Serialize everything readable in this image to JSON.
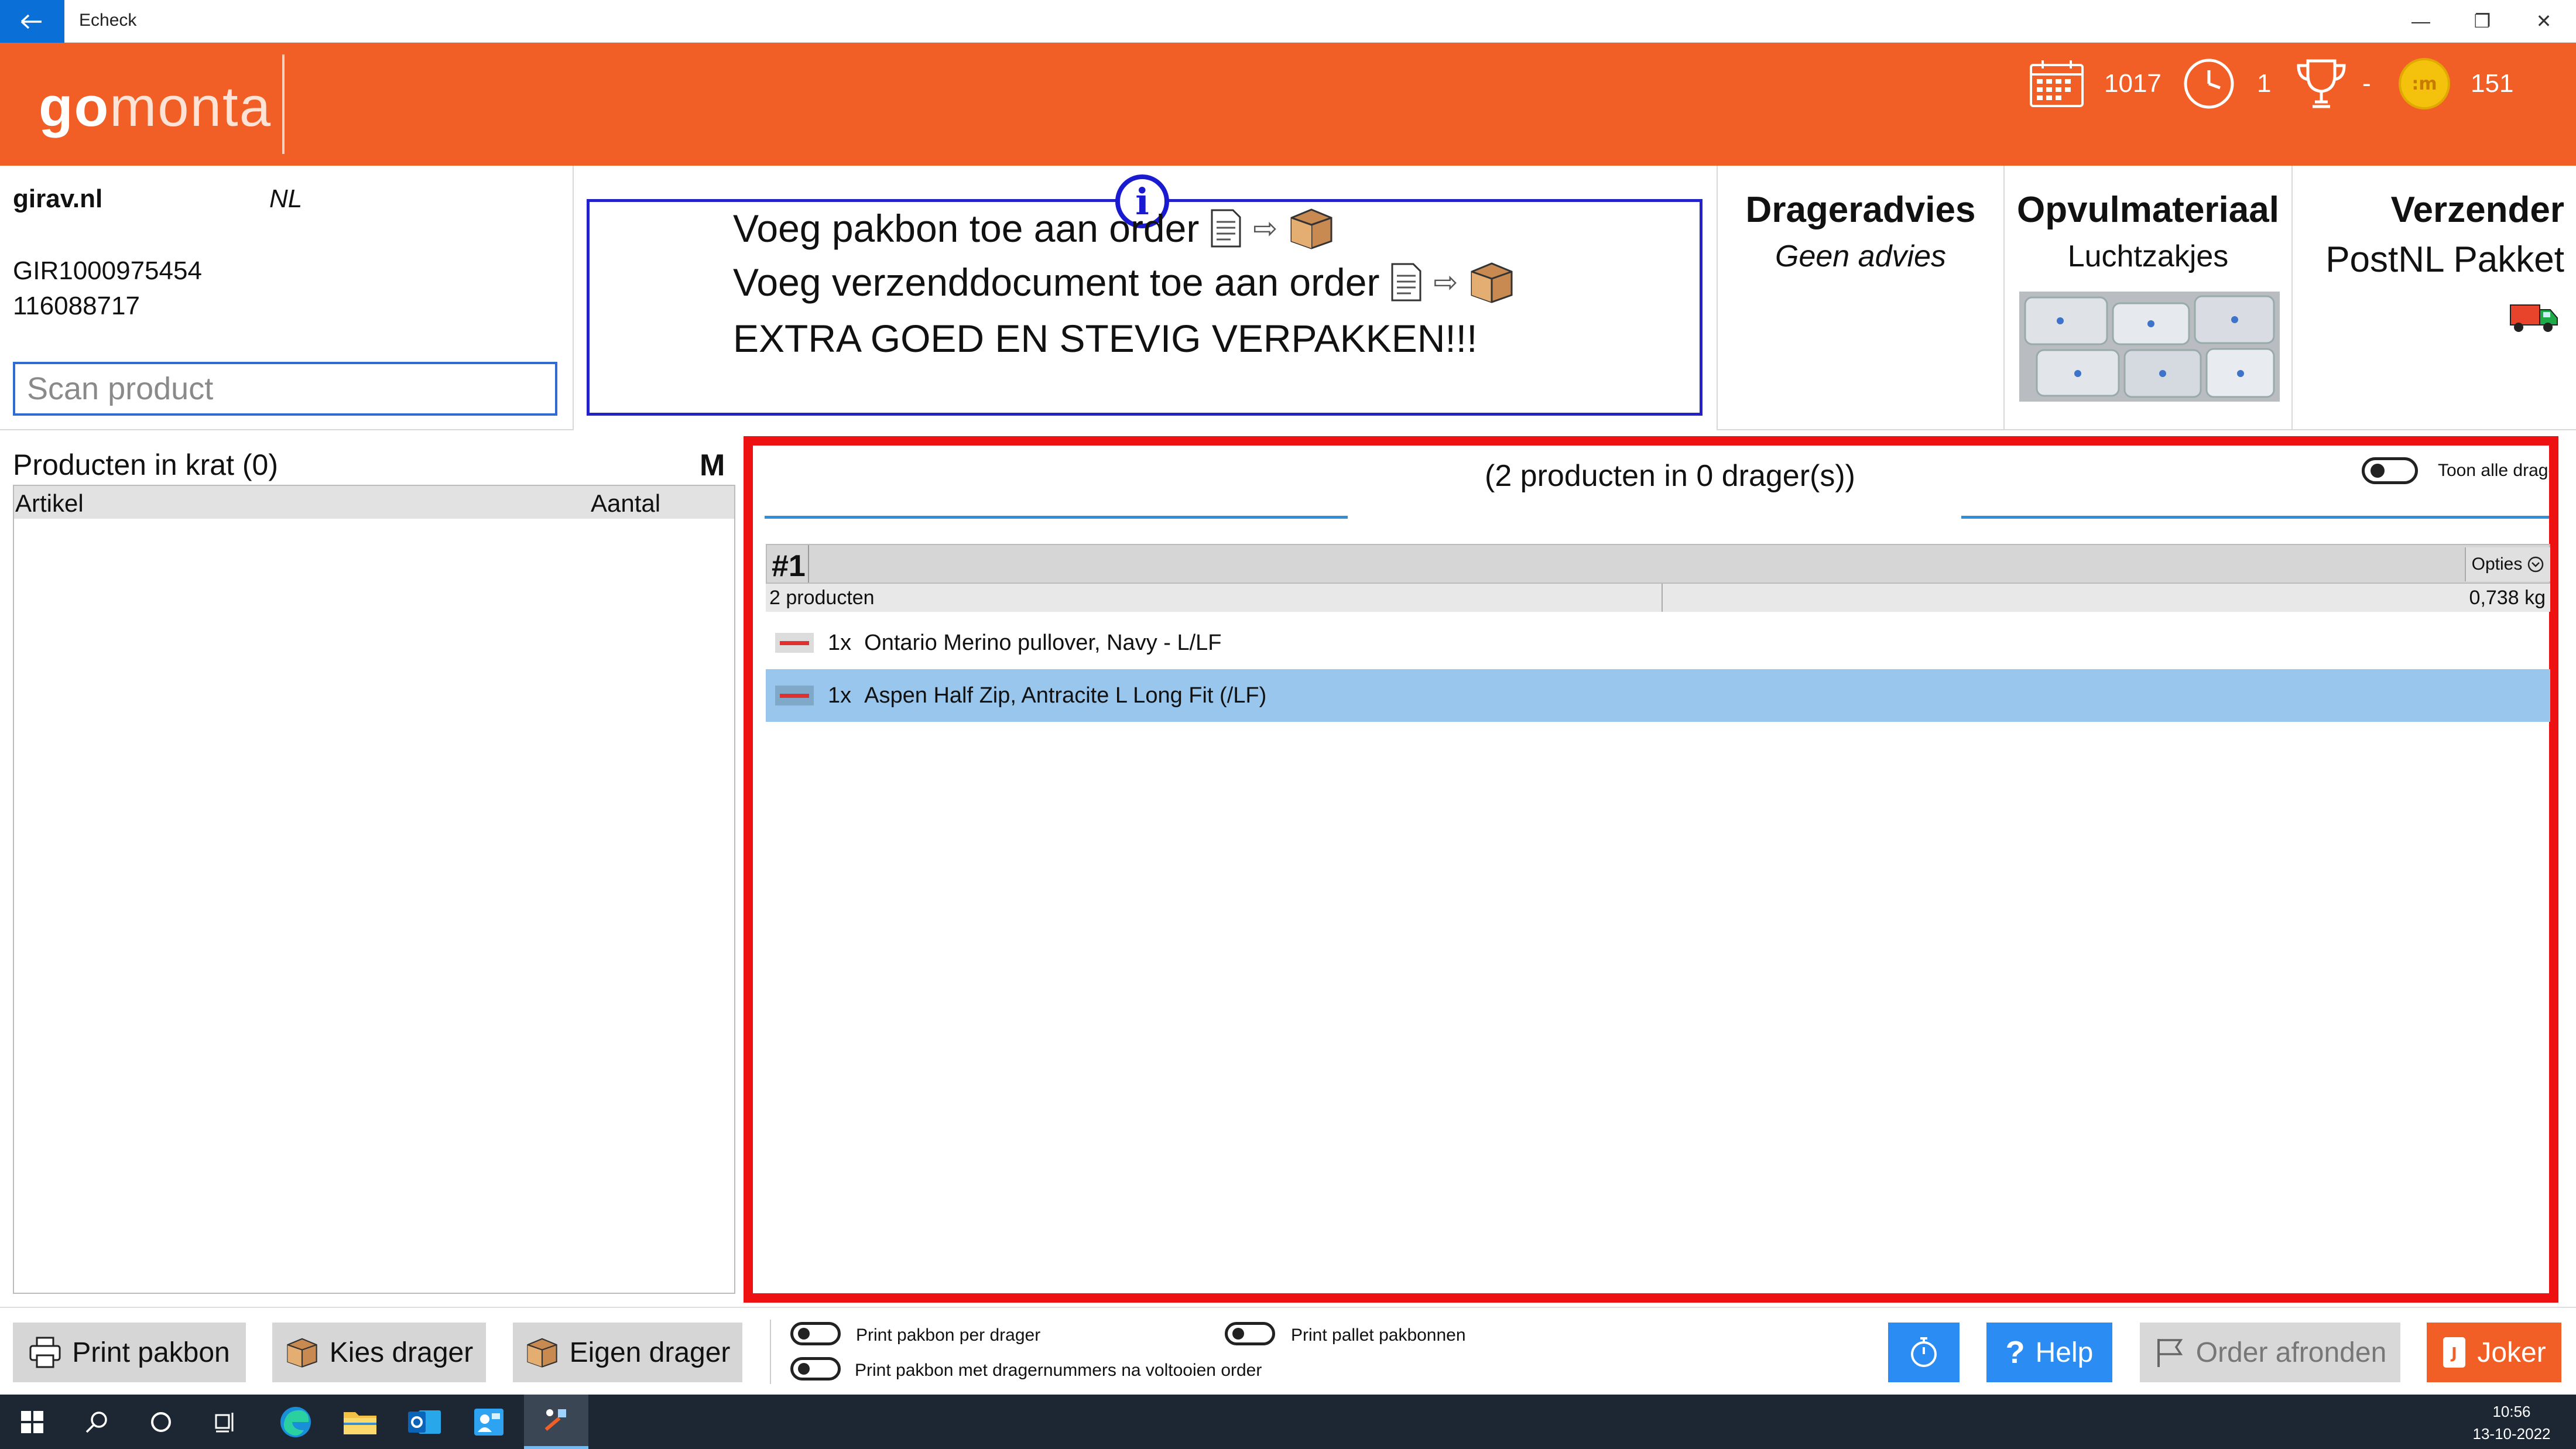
{
  "window": {
    "title": "Echeck",
    "minimize_label": "—",
    "restore_label": "❐",
    "close_label": "✕"
  },
  "header": {
    "logo_go": "go",
    "logo_monta": "monta",
    "stats": {
      "calendar_value": "1017",
      "clock_value": "1",
      "trophy_value": "-",
      "coin_value": "151"
    },
    "brand_color": "#f15f26"
  },
  "order": {
    "shop": "girav.nl",
    "country": "NL",
    "order_id": "GIR1000975454",
    "order_number": "116088717",
    "scan_placeholder": "Scan product"
  },
  "instructions": {
    "line1": "Voeg pakbon toe aan order",
    "line2": "Voeg verzenddocument toe aan order",
    "line3": "EXTRA GOED EN STEVIG VERPAKKEN!!!",
    "info_icon": "i",
    "arrow": "⇨"
  },
  "panels": {
    "carrier_advice_title": "Drageradvies",
    "carrier_advice_value": "Geen advies",
    "filler_title": "Opvulmateriaal",
    "filler_value": "Luchtzakjes",
    "shipper_title": "Verzender",
    "shipper_value": "PostNL Pakket"
  },
  "crate": {
    "title": "Producten in krat (0)",
    "size": "M",
    "col_article": "Artikel",
    "col_amount": "Aantal"
  },
  "carriers": {
    "summary": "(2 producten in 0 drager(s))",
    "toggle_all_label": "Toon alle dragers",
    "carrier_number": "#1",
    "options_label": "Opties",
    "product_count": "2 producten",
    "weight": "0,738 kg",
    "items": [
      {
        "qty": "1x",
        "name": "Ontario Merino pullover, Navy - L/LF",
        "selected": false
      },
      {
        "qty": "1x",
        "name": "Aspen Half Zip, Antracite L Long Fit (/LF)",
        "selected": true
      }
    ]
  },
  "toolbar": {
    "print_packslip": "Print pakbon",
    "choose_carrier": "Kies drager",
    "own_carrier": "Eigen drager",
    "toggle_per_carrier": "Print pakbon per drager",
    "toggle_with_numbers": "Print pakbon met dragernummers na voltooien order",
    "toggle_pallet": "Print pallet pakbonnen",
    "help": "Help",
    "finish_order": "Order afronden",
    "joker": "Joker"
  },
  "taskbar": {
    "time": "10:56",
    "date": "13-10-2022"
  }
}
